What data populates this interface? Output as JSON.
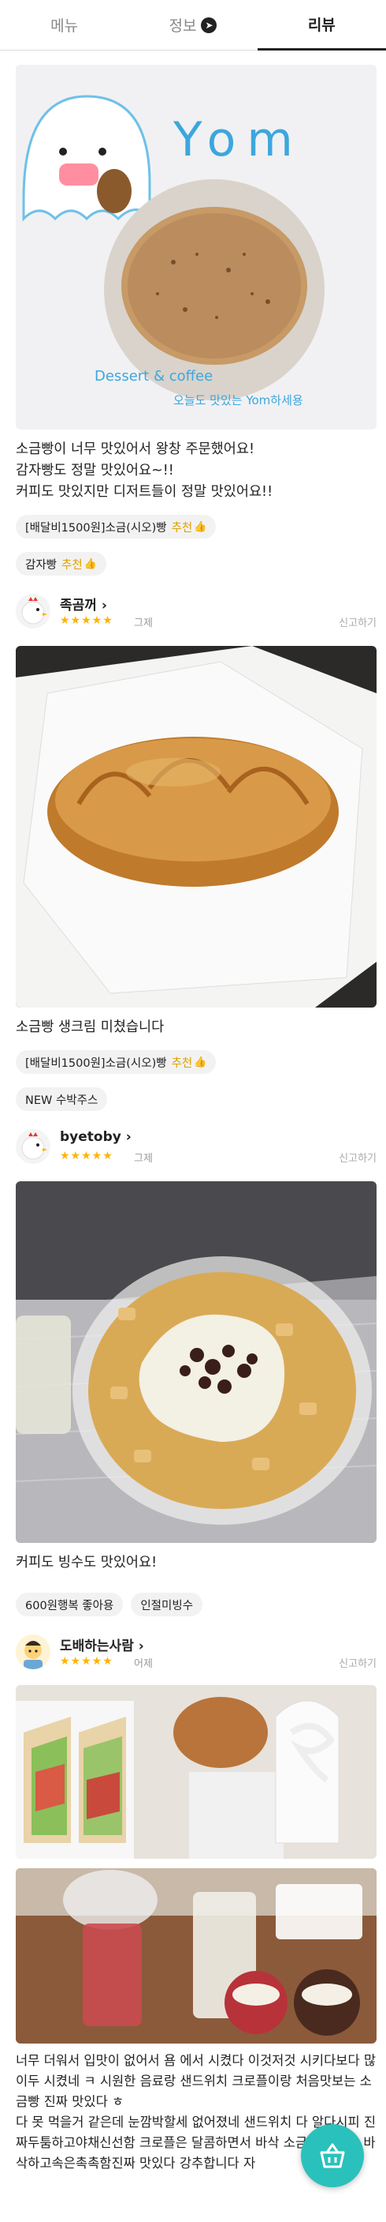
{
  "tabs": [
    {
      "label": "메뉴"
    },
    {
      "label": "정보"
    },
    {
      "label": "리뷰"
    }
  ],
  "reviews": [
    {
      "photo_text": {
        "brand": "Yom",
        "tag1": "Dessert & coffee",
        "tag2": "오늘도 맛있는 Yom하세용"
      },
      "text": "소금빵이 너무 맛있어서 왕창 주문했어요!\n감자빵도 정말 맛있어요~!!\n커피도 맛있지만 디저트들이 정말 맛있어요!!",
      "chips": [
        {
          "name": "[배달비1500원]소금(시오)빵",
          "rec": "추천"
        },
        {
          "name": "감자빵",
          "rec": "추천"
        }
      ]
    },
    {
      "name": "족곰꺼 ›",
      "stars": "★★★★★",
      "date": "그제",
      "report": "신고하기",
      "text": "소금빵 생크림 미쳤습니다",
      "chips": [
        {
          "name": "[배달비1500원]소금(시오)빵",
          "rec": "추천"
        },
        {
          "name": "NEW 수박주스",
          "rec": ""
        }
      ]
    },
    {
      "name": "byetoby ›",
      "stars": "★★★★★",
      "date": "그제",
      "report": "신고하기",
      "text": "커피도 빙수도 맛있어요!",
      "chips": [
        {
          "name": "600원행복 좋아용",
          "rec": ""
        },
        {
          "name": "인절미빙수",
          "rec": ""
        }
      ]
    },
    {
      "name": "도배하는사람 ›",
      "stars": "★★★★★",
      "date": "어제",
      "report": "신고하기",
      "text": "너무 더워서 입맛이 없어서  욤 에서 시켰다 이것저것  시키다보다 많이두 시켰네 ㅋ 시원한 음료랑 샌드위치 크로플이랑 처음맛보는 소금빵  진짜 맛있다 ㅎ\n다 못 먹을거 같은데 눈깜박할세 없어졌네 샌드위치 다 알다시피 진짜두툼하고야채신선함 크로플은 달콤하면서 바삭 소금빵은 겉은 바삭하고속은촉촉함진짜 맛있다 강추합니다 자"
    }
  ],
  "colors": {
    "accent": "#2ac1bc",
    "star": "#ffb300",
    "recommend": "#e0a200"
  }
}
